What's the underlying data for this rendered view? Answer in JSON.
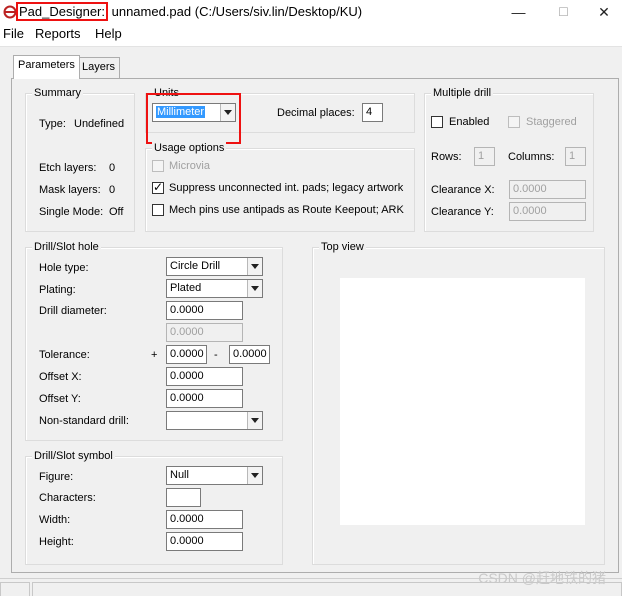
{
  "window": {
    "app_name": "Pad_Designer:",
    "file_title": " unnamed.pad (C:/Users/siv.lin/Desktop/KU)",
    "minimize_glyph": "—",
    "maximize_glyph": "☐",
    "close_glyph": "✕"
  },
  "menu": {
    "file": "File",
    "reports": "Reports",
    "help": "Help"
  },
  "tabs": {
    "parameters": "Parameters",
    "layers": "Layers"
  },
  "summary": {
    "title": "Summary",
    "type_label": "Type:",
    "type_value": "Undefined",
    "etch_label": "Etch layers:",
    "etch_value": "0",
    "mask_label": "Mask layers:",
    "mask_value": "0",
    "single_label": "Single Mode:",
    "single_value": "Off"
  },
  "units": {
    "title": "Units",
    "unit_value": "Millimeter",
    "decimal_label": "Decimal places:",
    "decimal_value": "4"
  },
  "usage": {
    "title": "Usage options",
    "microvia": "Microvia",
    "suppress": "Suppress unconnected int. pads; legacy artwork",
    "mech": "Mech pins use antipads as Route Keepout; ARK"
  },
  "multidrill": {
    "title": "Multiple drill",
    "enabled": "Enabled",
    "staggered": "Staggered",
    "rows_label": "Rows:",
    "rows_value": "1",
    "cols_label": "Columns:",
    "cols_value": "1",
    "cx_label": "Clearance X:",
    "cx_value": "0.0000",
    "cy_label": "Clearance Y:",
    "cy_value": "0.0000"
  },
  "drill": {
    "title": "Drill/Slot hole",
    "hole_type_label": "Hole type:",
    "hole_type_value": "Circle Drill",
    "plating_label": "Plating:",
    "plating_value": "Plated",
    "diameter_label": "Drill diameter:",
    "diameter_value": "0.0000",
    "diameter_value2": "0.0000",
    "tolerance_label": "Tolerance:",
    "tol_plus": "+",
    "tol_plus_value": "0.0000",
    "tol_minus": "-",
    "tol_minus_value": "0.0000",
    "offx_label": "Offset X:",
    "offx_value": "0.0000",
    "offy_label": "Offset Y:",
    "offy_value": "0.0000",
    "nonstd_label": "Non-standard drill:",
    "nonstd_value": ""
  },
  "symbol": {
    "title": "Drill/Slot symbol",
    "figure_label": "Figure:",
    "figure_value": "Null",
    "chars_label": "Characters:",
    "chars_value": "",
    "width_label": "Width:",
    "width_value": "0.0000",
    "height_label": "Height:",
    "height_value": "0.0000"
  },
  "topview": {
    "title": "Top view"
  },
  "watermark": "CSDN @赶地铁的猪",
  "colors": {
    "highlight": "#e11111",
    "selection": "#3399ff"
  }
}
